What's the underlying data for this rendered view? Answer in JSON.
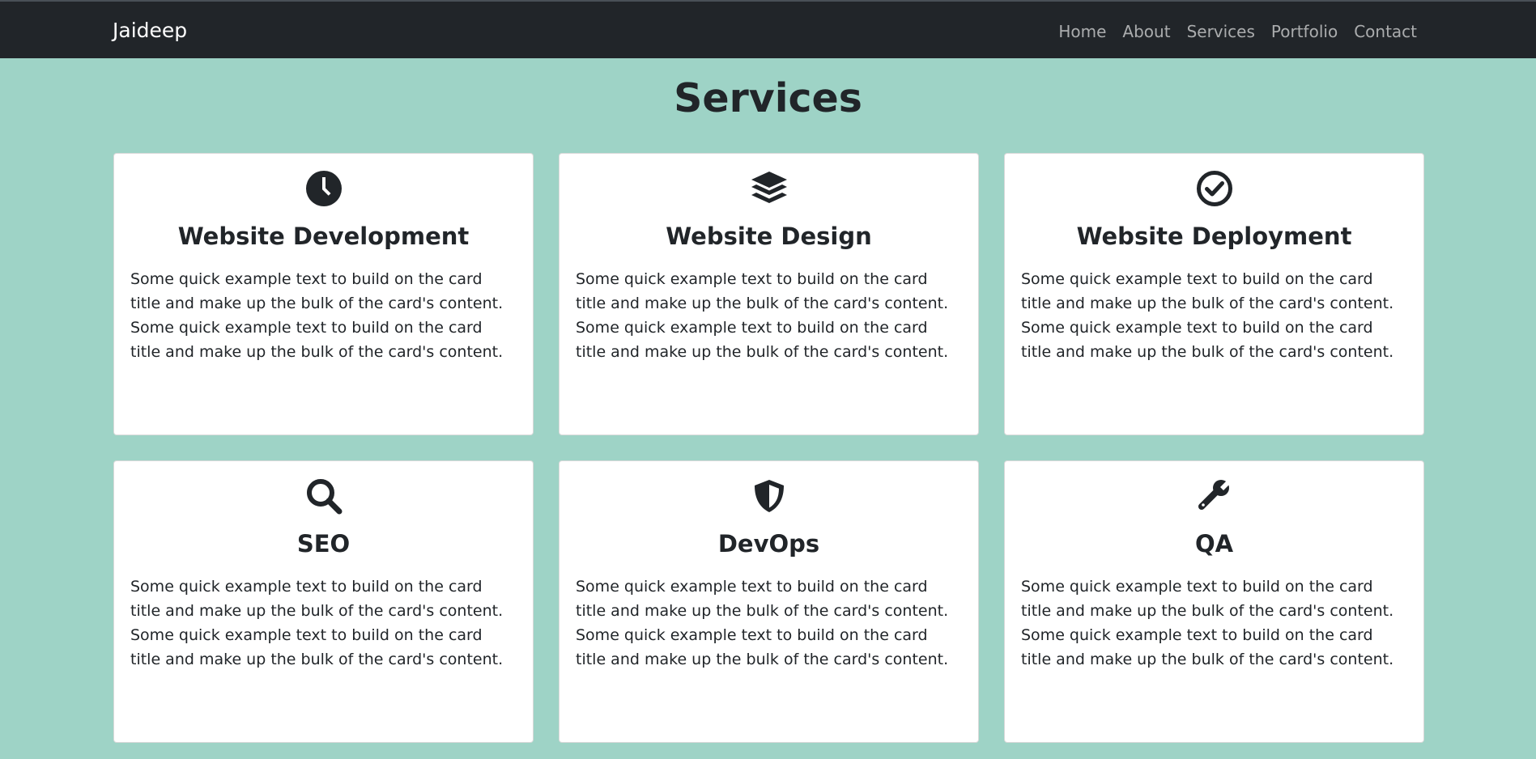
{
  "navbar": {
    "brand": "Jaideep",
    "links": [
      {
        "label": "Home"
      },
      {
        "label": "About"
      },
      {
        "label": "Services"
      },
      {
        "label": "Portfolio"
      },
      {
        "label": "Contact"
      }
    ]
  },
  "section": {
    "title": "Services"
  },
  "cards": [
    {
      "icon": "clock-icon",
      "title": "Website Development",
      "text": "Some quick example text to build on the card title and make up the bulk of the card's content. Some quick example text to build on the card title and make up the bulk of the card's content."
    },
    {
      "icon": "layers-icon",
      "title": "Website Design",
      "text": "Some quick example text to build on the card title and make up the bulk of the card's content. Some quick example text to build on the card title and make up the bulk of the card's content."
    },
    {
      "icon": "check-circle-icon",
      "title": "Website Deployment",
      "text": "Some quick example text to build on the card title and make up the bulk of the card's content. Some quick example text to build on the card title and make up the bulk of the card's content."
    },
    {
      "icon": "search-icon",
      "title": "SEO",
      "text": "Some quick example text to build on the card title and make up the bulk of the card's content. Some quick example text to build on the card title and make up the bulk of the card's content."
    },
    {
      "icon": "shield-icon",
      "title": "DevOps",
      "text": "Some quick example text to build on the card title and make up the bulk of the card's content. Some quick example text to build on the card title and make up the bulk of the card's content."
    },
    {
      "icon": "wrench-icon",
      "title": "QA",
      "text": "Some quick example text to build on the card title and make up the bulk of the card's content. Some quick example text to build on the card title and make up the bulk of the card's content."
    }
  ],
  "colors": {
    "page_background": "#9ed3c6",
    "navbar_background": "#212529",
    "card_background": "#ffffff",
    "text": "#212529"
  }
}
